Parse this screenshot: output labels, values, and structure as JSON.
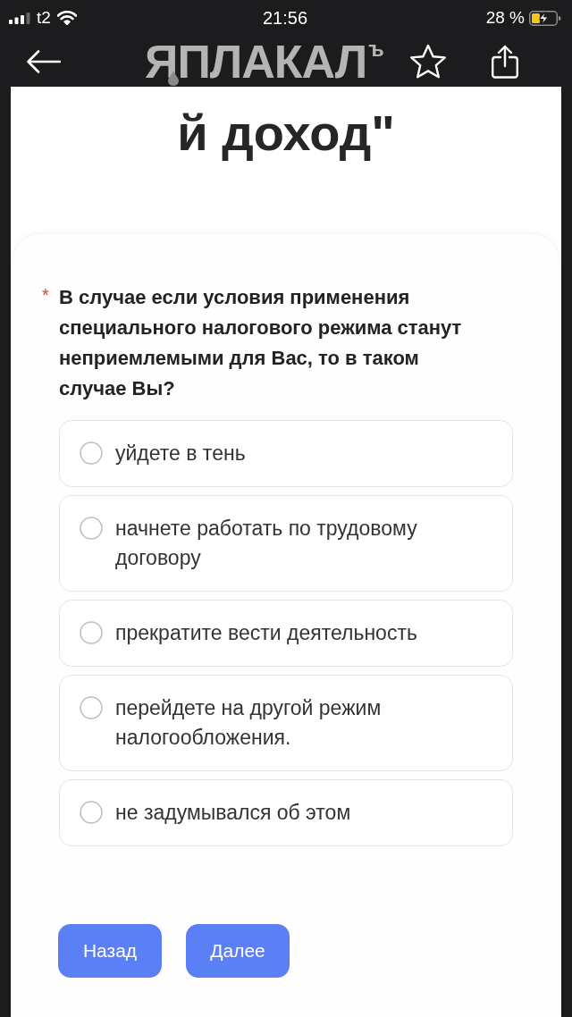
{
  "status_bar": {
    "carrier": "t2",
    "time": "21:56",
    "battery": "28 %"
  },
  "nav_bar": {
    "logo": "ЯПЛАКАЛ",
    "logo_mark": "ъ"
  },
  "form": {
    "title": "й доход\"",
    "question": {
      "required_mark": "*",
      "text": "В случае если условия применения специального налогового режима станут неприемлемыми для Вас, то в таком случае Вы?"
    },
    "options": [
      {
        "label": "уйдете в тень",
        "selected": false
      },
      {
        "label": "начнете работать по трудовому договору",
        "selected": false
      },
      {
        "label": "прекратите вести деятельность",
        "selected": false
      },
      {
        "label": "перейдете на другой режим налогообложения.",
        "selected": false
      },
      {
        "label": "не задумывался об этом",
        "selected": false
      }
    ],
    "buttons": [
      "Назад",
      "Далее"
    ]
  }
}
